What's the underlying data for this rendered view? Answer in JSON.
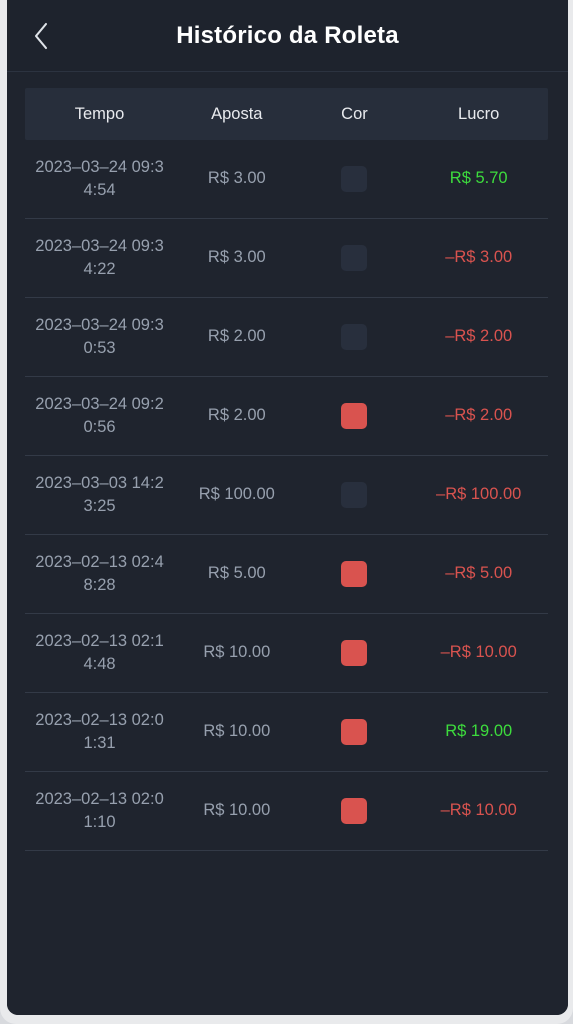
{
  "titlebar": {
    "back_icon": "chevron-left-icon",
    "title": "Histórico da Roleta"
  },
  "table": {
    "columns": [
      {
        "key": "tempo",
        "label": "Tempo"
      },
      {
        "key": "aposta",
        "label": "Aposta"
      },
      {
        "key": "cor",
        "label": "Cor"
      },
      {
        "key": "lucro",
        "label": "Lucro"
      }
    ],
    "colors": {
      "dark_swatch": "#282f3d",
      "red_swatch": "#d9534f",
      "profit_text": "#3ddc3d",
      "loss_text": "#d9534f",
      "body_text": "#97a0ae",
      "header_text": "#e8eaee",
      "screen_bg": "#1f242e",
      "header_bg": "#272e3b",
      "row_divider": "#333a47"
    },
    "rows": [
      {
        "tempo": "2023–03–24 09:34:54",
        "aposta": "R$ 3.00",
        "cor": "#282f3d",
        "cor_name": "dark",
        "lucro": "R$ 5.70",
        "lucro_type": "profit"
      },
      {
        "tempo": "2023–03–24 09:34:22",
        "aposta": "R$ 3.00",
        "cor": "#282f3d",
        "cor_name": "dark",
        "lucro": "–R$ 3.00",
        "lucro_type": "loss"
      },
      {
        "tempo": "2023–03–24 09:30:53",
        "aposta": "R$ 2.00",
        "cor": "#282f3d",
        "cor_name": "dark",
        "lucro": "–R$ 2.00",
        "lucro_type": "loss"
      },
      {
        "tempo": "2023–03–24 09:20:56",
        "aposta": "R$ 2.00",
        "cor": "#d9534f",
        "cor_name": "red",
        "lucro": "–R$ 2.00",
        "lucro_type": "loss"
      },
      {
        "tempo": "2023–03–03 14:23:25",
        "aposta": "R$ 100.00",
        "cor": "#282f3d",
        "cor_name": "dark",
        "lucro": "–R$ 100.00",
        "lucro_type": "loss"
      },
      {
        "tempo": "2023–02–13 02:48:28",
        "aposta": "R$ 5.00",
        "cor": "#d9534f",
        "cor_name": "red",
        "lucro": "–R$ 5.00",
        "lucro_type": "loss"
      },
      {
        "tempo": "2023–02–13 02:14:48",
        "aposta": "R$ 10.00",
        "cor": "#d9534f",
        "cor_name": "red",
        "lucro": "–R$ 10.00",
        "lucro_type": "loss"
      },
      {
        "tempo": "2023–02–13 02:01:31",
        "aposta": "R$ 10.00",
        "cor": "#d9534f",
        "cor_name": "red",
        "lucro": "R$ 19.00",
        "lucro_type": "profit"
      },
      {
        "tempo": "2023–02–13 02:01:10",
        "aposta": "R$ 10.00",
        "cor": "#d9534f",
        "cor_name": "red",
        "lucro": "–R$ 10.00",
        "lucro_type": "loss"
      }
    ]
  }
}
